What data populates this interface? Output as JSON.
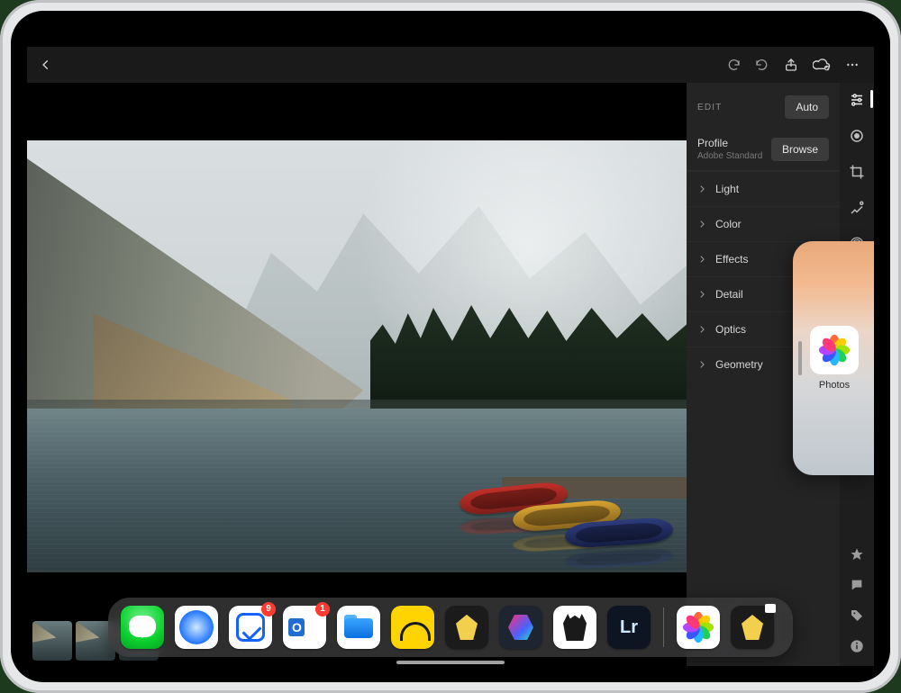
{
  "topbar": {
    "back_icon": "chevron-left",
    "actions": {
      "redo": "redo-icon",
      "undo": "undo-icon",
      "share": "share-icon",
      "cloud": "cloud-check-icon",
      "more": "more-icon"
    }
  },
  "edit_panel": {
    "header_label": "EDIT",
    "auto_button": "Auto",
    "profile": {
      "title": "Profile",
      "subtitle": "Adobe Standard",
      "browse_button": "Browse"
    },
    "sections": [
      {
        "label": "Light"
      },
      {
        "label": "Color"
      },
      {
        "label": "Effects"
      },
      {
        "label": "Detail"
      },
      {
        "label": "Optics"
      },
      {
        "label": "Geometry"
      }
    ]
  },
  "toolstrip": {
    "top": [
      {
        "name": "adjust-sliders-icon",
        "active": true
      },
      {
        "name": "presets-icon"
      },
      {
        "name": "crop-icon"
      },
      {
        "name": "healing-brush-icon"
      },
      {
        "name": "masking-icon"
      },
      {
        "name": "radial-gradient-icon"
      }
    ],
    "bottom": [
      {
        "name": "rate-star-icon"
      },
      {
        "name": "comments-icon"
      },
      {
        "name": "keywords-tag-icon"
      },
      {
        "name": "info-icon"
      }
    ]
  },
  "slideover": {
    "app_name": "Photos",
    "label": "Photos"
  },
  "dock": {
    "apps": [
      {
        "name": "Messages"
      },
      {
        "name": "Safari"
      },
      {
        "name": "Things",
        "badge": "9"
      },
      {
        "name": "Outlook",
        "badge": "1"
      },
      {
        "name": "Files"
      },
      {
        "name": "Basecamp"
      },
      {
        "name": "Drafts"
      },
      {
        "name": "Shortcuts"
      },
      {
        "name": "Bear"
      },
      {
        "name": "Lightroom"
      }
    ],
    "recent": [
      {
        "name": "Photos"
      },
      {
        "name": "Drafts"
      }
    ]
  },
  "filmstrip": {
    "count": 3
  }
}
